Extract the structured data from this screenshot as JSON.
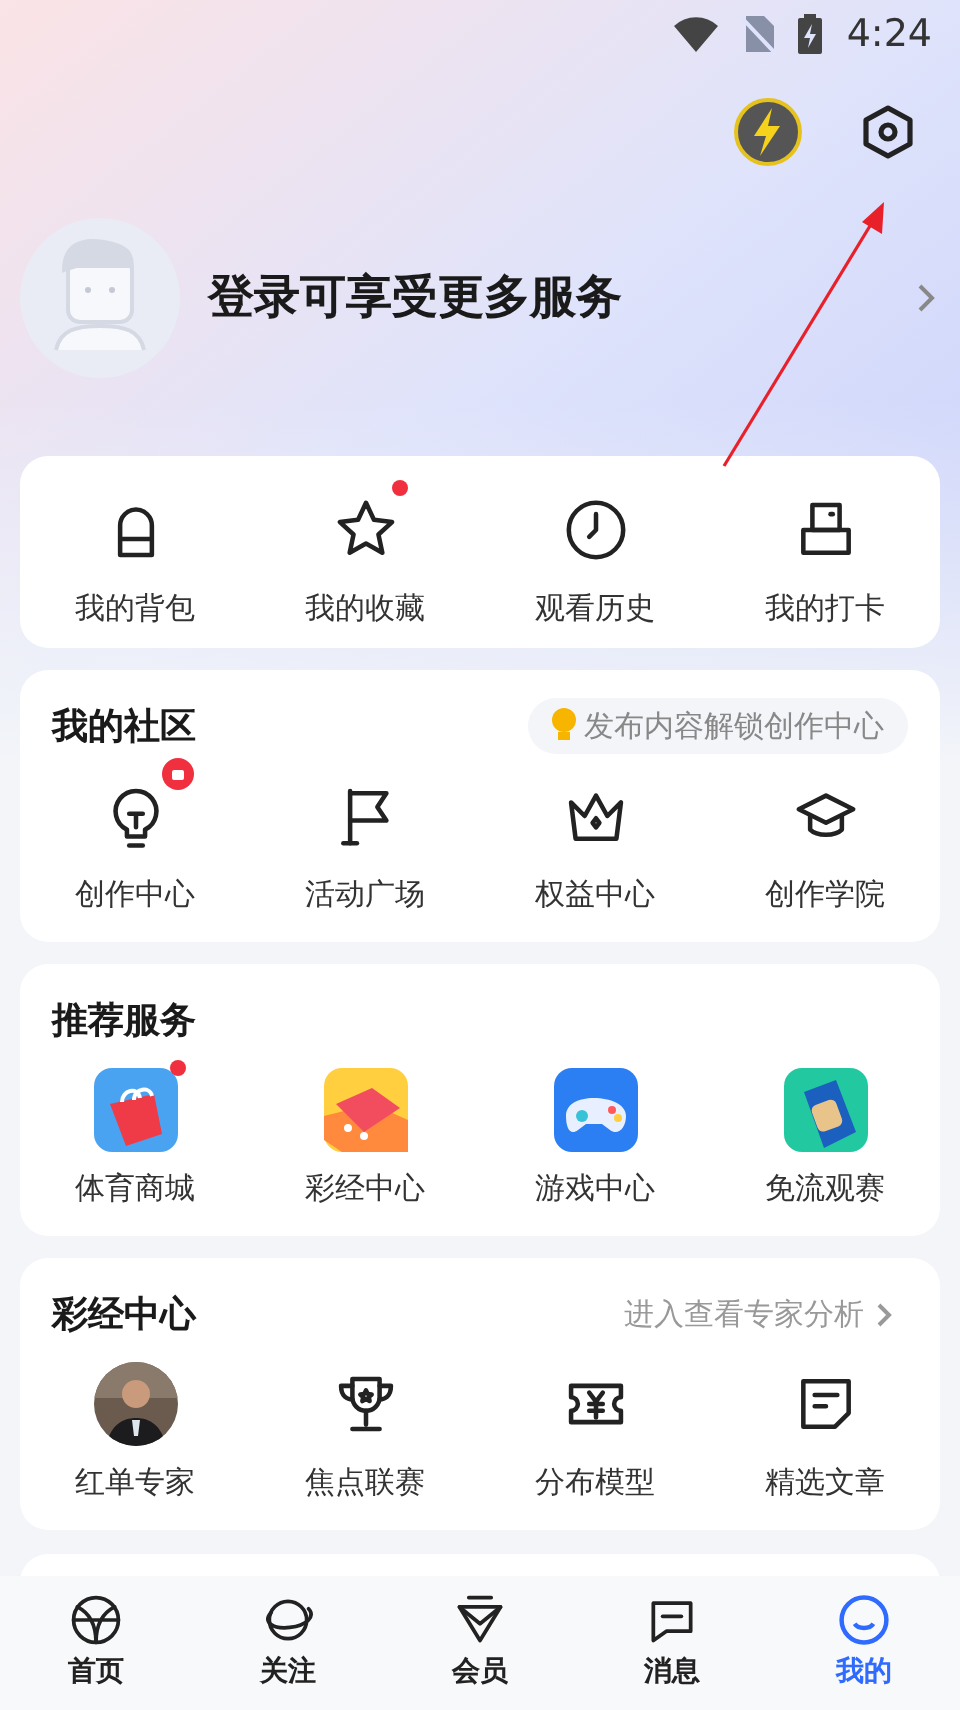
{
  "status_bar": {
    "time": "4:24"
  },
  "profile": {
    "prompt": "登录可享受更多服务"
  },
  "quick_links": [
    {
      "label": "我的背包",
      "has_dot": false
    },
    {
      "label": "我的收藏",
      "has_dot": true
    },
    {
      "label": "观看历史",
      "has_dot": false
    },
    {
      "label": "我的打卡",
      "has_dot": false
    }
  ],
  "sections": [
    {
      "title": "我的社区",
      "hint": "发布内容解锁创作中心",
      "items": [
        {
          "label": "创作中心",
          "locked": true
        },
        {
          "label": "活动广场",
          "locked": false
        },
        {
          "label": "权益中心",
          "locked": false
        },
        {
          "label": "创作学院",
          "locked": false
        }
      ]
    },
    {
      "title": "推荐服务",
      "items": [
        {
          "label": "体育商城",
          "has_dot": true
        },
        {
          "label": "彩经中心",
          "has_dot": false
        },
        {
          "label": "游戏中心",
          "has_dot": false
        },
        {
          "label": "免流观赛",
          "has_dot": false
        }
      ]
    },
    {
      "title": "彩经中心",
      "link": "进入查看专家分析",
      "items": [
        {
          "label": "红单专家"
        },
        {
          "label": "焦点联赛"
        },
        {
          "label": "分布模型"
        },
        {
          "label": "精选文章"
        }
      ]
    }
  ],
  "tab_bar": [
    {
      "label": "首页",
      "selected": false
    },
    {
      "label": "关注",
      "selected": false
    },
    {
      "label": "会员",
      "selected": false
    },
    {
      "label": "消息",
      "selected": false
    },
    {
      "label": "我的",
      "selected": true
    }
  ]
}
